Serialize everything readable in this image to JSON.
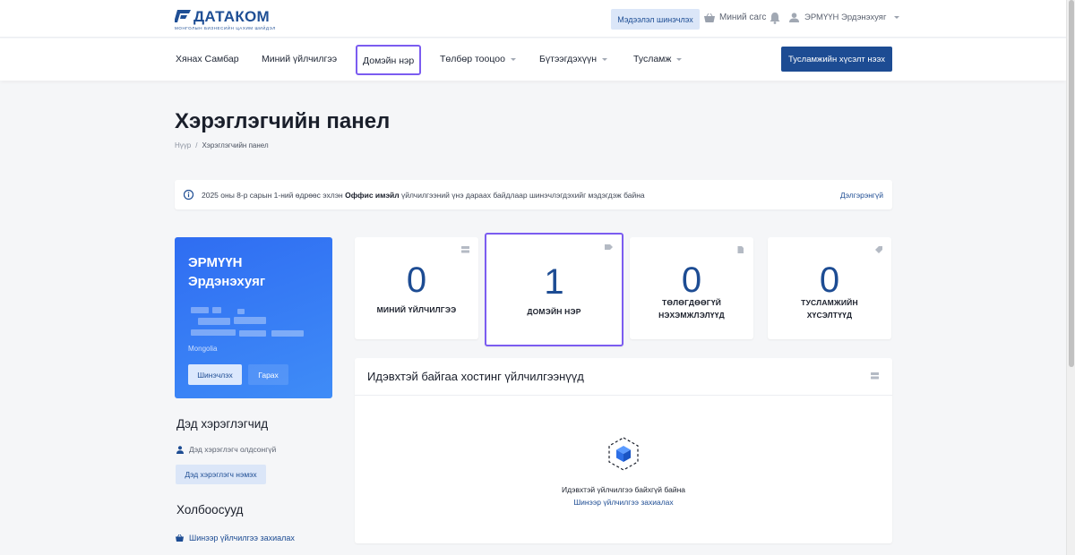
{
  "topbar": {
    "logo_text": "ДАТАКОМ",
    "logo_sub": "МОНГОЛЫН БИЗНЕСИЙН ЦАХИМ ШИЙДЭЛ",
    "profile_button": "Мэдээлэл шинэчлэх",
    "cart_label": "Миний сагс",
    "user_name": "ЭРМҮҮН Эрдэнэхуяг",
    "icons": [
      "basket-icon",
      "bell-icon",
      "user-icon"
    ]
  },
  "nav": {
    "items": [
      {
        "label": "Хянах Самбар",
        "dropdown": false
      },
      {
        "label": "Миний үйлчилгээ",
        "dropdown": false
      },
      {
        "label": "Домэйн нэр",
        "dropdown": false,
        "active": true
      },
      {
        "label": "Төлбөр тооцоо",
        "dropdown": true
      },
      {
        "label": "Бүтээгдэхүүн",
        "dropdown": true
      },
      {
        "label": "Тусламж",
        "dropdown": true
      }
    ],
    "cta": "Тусламжийн хүсэлт нээх"
  },
  "page": {
    "title": "Хэрэглэгчийн панел",
    "breadcrumb_home": "Нүүр",
    "breadcrumb_current": "Хэрэглэгчийн панел"
  },
  "alert": {
    "text_before": "2025 оны 8-р сарын 1-ний өдрөөс эхлэн ",
    "text_bold": "Оффис имэйл",
    "text_after": " үйлчилгээний үнэ дараах байдлаар шинэчлэгдэхийг мэдэгдэж байна",
    "link": "Дэлгэрэнгүй"
  },
  "profile": {
    "first_line": "ЭРМҮҮН",
    "second_line": "Эрдэнэхуяг",
    "country": "Mongolia",
    "edit_button": "Шинэчлэх",
    "logout_button": "Гарах"
  },
  "subaccounts": {
    "title": "Дэд хэрэглэгчид",
    "empty_note": "Дэд хэрэглэгч олдсонгүй",
    "add_button": "Дэд хэрэглэгч нэмэх"
  },
  "links": {
    "title": "Холбоосууд",
    "order_link": "Шинээр үйлчилгээ захиалах"
  },
  "stats": [
    {
      "value": "0",
      "label": "МИНИЙ ҮЙЛЧИЛГЭЭ",
      "label2": "",
      "icon": "server-icon"
    },
    {
      "value": "1",
      "label": "ДОМЭЙН НЭР",
      "label2": "",
      "icon": "tag-icon",
      "highlighted": true
    },
    {
      "value": "0",
      "label": "ТӨЛӨГДӨӨГҮЙ",
      "label2": "НЭХЭМЖЛЭЛҮҮД",
      "icon": "document-icon"
    },
    {
      "value": "0",
      "label": "ТУСЛАМЖИЙН",
      "label2": "ХҮСЭЛТҮҮД",
      "icon": "ticket-icon"
    }
  ],
  "hosting": {
    "title": "Идэвхтэй байгаа хостинг үйлчилгээнүүд",
    "empty_text": "Идэвхтэй үйлчилгээ байхгүй байна",
    "empty_link": "Шинээр үйлчилгээ захиалах"
  },
  "colors": {
    "brand": "#1d4c93",
    "profile_card": "#2f6df2",
    "highlight_outline": "#7b5cf0",
    "background": "#f5f6f8"
  }
}
